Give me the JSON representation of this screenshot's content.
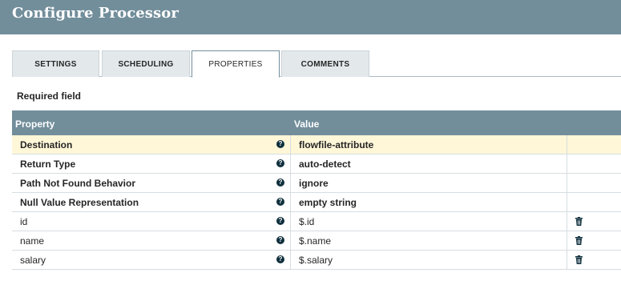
{
  "dialog": {
    "title": "Configure Processor"
  },
  "tabs": [
    {
      "label": "SETTINGS",
      "active": false
    },
    {
      "label": "SCHEDULING",
      "active": false
    },
    {
      "label": "PROPERTIES",
      "active": true
    },
    {
      "label": "COMMENTS",
      "active": false
    }
  ],
  "required_label": "Required field",
  "table": {
    "headers": {
      "property": "Property",
      "value": "Value"
    },
    "rows": [
      {
        "name": "Destination",
        "value": "flowfile-attribute",
        "required": true,
        "selected": true,
        "deletable": false
      },
      {
        "name": "Return Type",
        "value": "auto-detect",
        "required": true,
        "selected": false,
        "deletable": false
      },
      {
        "name": "Path Not Found Behavior",
        "value": "ignore",
        "required": true,
        "selected": false,
        "deletable": false
      },
      {
        "name": "Null Value Representation",
        "value": "empty string",
        "required": true,
        "selected": false,
        "deletable": false
      },
      {
        "name": "id",
        "value": "$.id",
        "required": false,
        "selected": false,
        "deletable": true
      },
      {
        "name": "name",
        "value": "$.name",
        "required": false,
        "selected": false,
        "deletable": true
      },
      {
        "name": "salary",
        "value": "$.salary",
        "required": false,
        "selected": false,
        "deletable": true
      }
    ],
    "help_icon": "question-circle-icon",
    "delete_icon": "trash-icon"
  },
  "colors": {
    "header_bg": "#728e9b",
    "selected_row_bg": "#fff7d8",
    "icon_color": "#0f2f3d"
  }
}
